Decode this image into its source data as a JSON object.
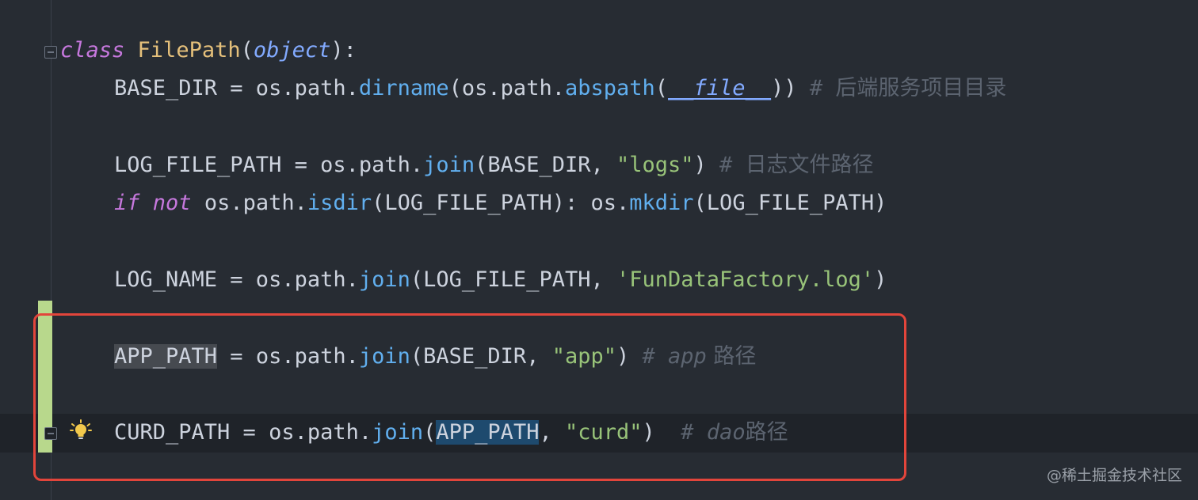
{
  "code": {
    "class_line": {
      "keyword": "class",
      "name": "FilePath",
      "open": "(",
      "base": "object",
      "close": "):"
    },
    "base_dir": {
      "lhs": "BASE_DIR = os.path.",
      "fn1": "dirname",
      "mid": "(os.path.",
      "fn2": "abspath",
      "open": "(",
      "dunder": "__file__",
      "close": ")) ",
      "comment_hash": "# ",
      "comment": "后端服务项目目录"
    },
    "log_file_path": {
      "lhs": "LOG_FILE_PATH = os.path.",
      "fn": "join",
      "args": "(BASE_DIR, ",
      "str": "\"logs\"",
      "close": ") ",
      "comment_hash": "# ",
      "comment": "日志文件路径"
    },
    "if_line": {
      "kw_if": "if",
      "kw_not": "not",
      "mid1": " os.path.",
      "fn1": "isdir",
      "mid2": "(LOG_FILE_PATH): os.",
      "fn2": "mkdir",
      "tail": "(LOG_FILE_PATH)"
    },
    "log_name": {
      "lhs": "LOG_NAME = os.path.",
      "fn": "join",
      "args": "(LOG_FILE_PATH, ",
      "str": "'FunDataFactory.log'",
      "close": ")"
    },
    "app_path": {
      "name": "APP_PATH",
      "rest": " = os.path.",
      "fn": "join",
      "args": "(BASE_DIR, ",
      "str": "\"app\"",
      "close": ") ",
      "comment_hash": "# ",
      "comment_word": "app",
      "comment_cjk": " 路径"
    },
    "curd_path": {
      "lhs": "CURD_PATH = os.path.",
      "fn": "join",
      "open": "(",
      "arg_sel": "APP_PATH",
      "comma": ", ",
      "str": "\"curd\"",
      "close": ")  ",
      "comment_hash": "# ",
      "comment_word": "dao",
      "comment_cjk": "路径"
    }
  },
  "watermark": "@稀土掘金技术社区",
  "colors": {
    "background": "#272c33",
    "current_line": "#1f2329",
    "keyword": "#c678dd",
    "class_name": "#e5c07b",
    "function": "#61afef",
    "string": "#98c379",
    "comment": "#5c6470",
    "annotation_box": "#e2453b",
    "vcs_change": "#b8d88c"
  },
  "icons": {
    "intention": "lightbulb-icon",
    "fold": "fold-marker-icon"
  }
}
